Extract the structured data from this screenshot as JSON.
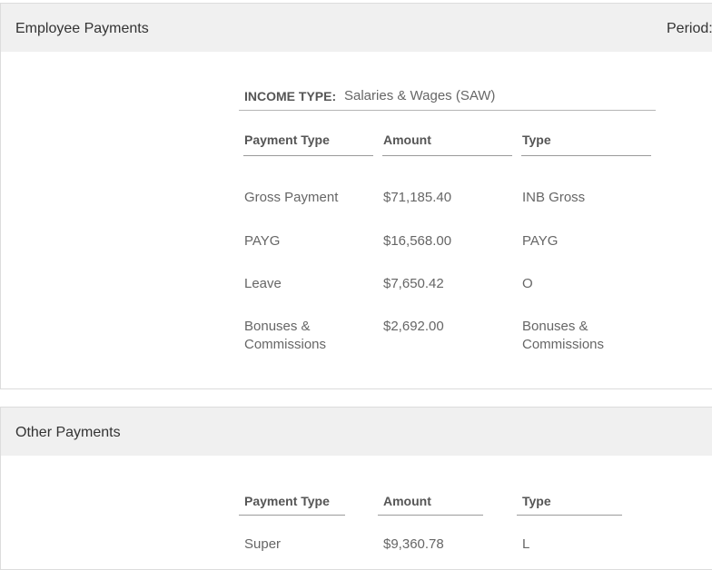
{
  "employee_payments": {
    "title": "Employee Payments",
    "period_label": "Period:",
    "income_type_label": "INCOME TYPE:",
    "income_type_value": "Salaries & Wages (SAW)",
    "columns": [
      "Payment Type",
      "Amount",
      "Type"
    ],
    "rows": [
      {
        "payment_type": "Gross Payment",
        "amount": "$71,185.40",
        "type": "INB Gross"
      },
      {
        "payment_type": "PAYG",
        "amount": "$16,568.00",
        "type": "PAYG"
      },
      {
        "payment_type": "Leave",
        "amount": "$7,650.42",
        "type": "O"
      },
      {
        "payment_type": "Bonuses & Commissions",
        "amount": "$2,692.00",
        "type": "Bonuses & Commissions"
      }
    ]
  },
  "other_payments": {
    "title": "Other Payments",
    "columns": [
      "Payment Type",
      "Amount",
      "Type"
    ],
    "rows": [
      {
        "payment_type": "Super",
        "amount": "$9,360.78",
        "type": "L"
      }
    ]
  }
}
